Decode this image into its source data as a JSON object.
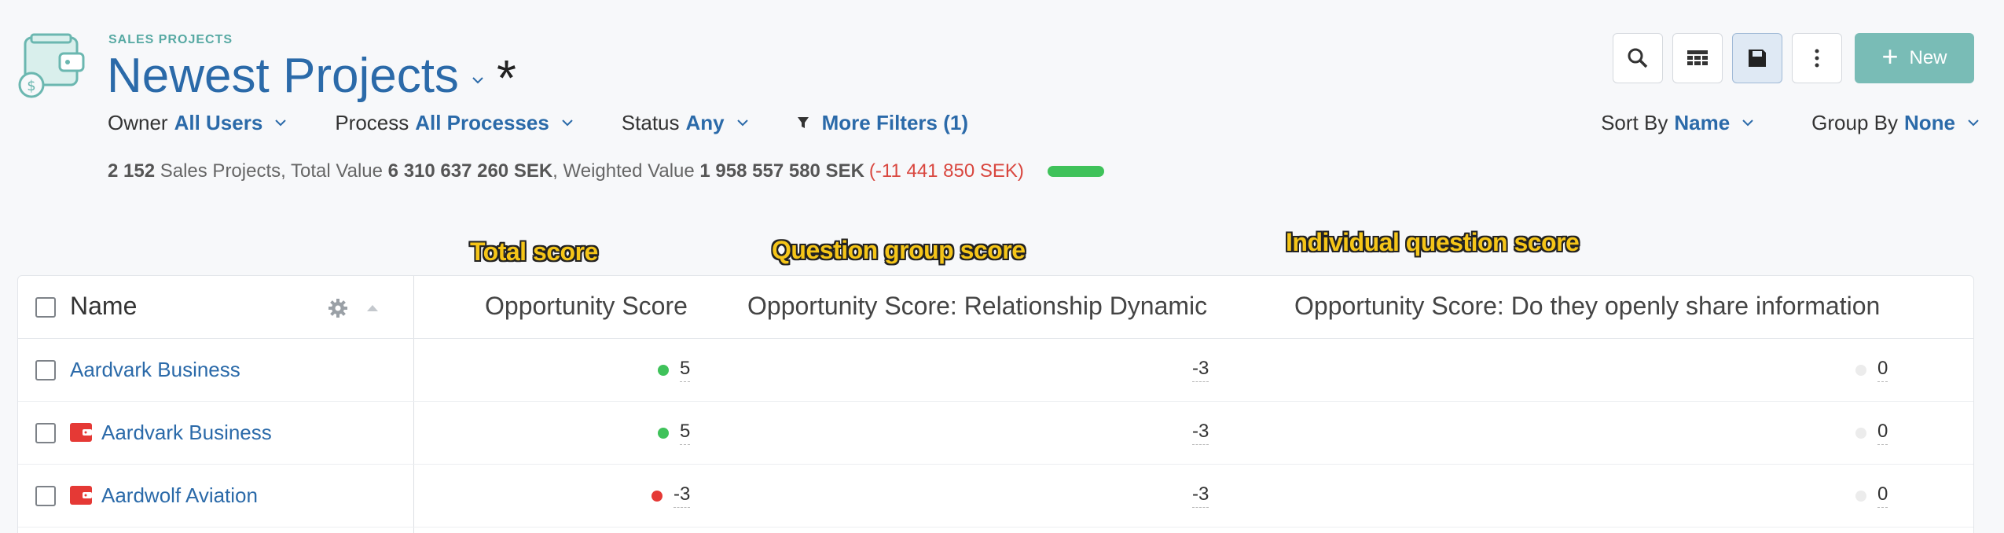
{
  "header": {
    "eyebrow": "SALES PROJECTS",
    "title": "Newest Projects",
    "unsaved_marker": "*"
  },
  "filters": {
    "owner_label": "Owner",
    "owner_value": "All Users",
    "process_label": "Process",
    "process_value": "All Processes",
    "status_label": "Status",
    "status_value": "Any",
    "more_filters": "More Filters (1)"
  },
  "sorting": {
    "sort_label": "Sort By",
    "sort_value": "Name",
    "group_label": "Group By",
    "group_value": "None"
  },
  "toolbar": {
    "new_label": "New"
  },
  "summary": {
    "count": "2 152",
    "count_text": " Sales Projects, Total Value ",
    "total_value": "6 310 637 260 SEK",
    "weighted_text": ", Weighted Value ",
    "weighted_value": "1 958 557 580 SEK",
    "delta": "(-11 441 850 SEK)"
  },
  "annotations": {
    "total": "Total score",
    "group": "Question group score",
    "individual": "Individual question score"
  },
  "table": {
    "columns": {
      "name": "Name",
      "opportunity_score": "Opportunity Score",
      "relationship_dynamic": "Opportunity Score: Relationship Dynamic",
      "share_information": "Opportunity Score: Do they openly share information"
    },
    "rows": [
      {
        "name": "Aardvark Business",
        "has_icon": false,
        "score": "5",
        "score_color": "#3fc25a",
        "group": "-3",
        "individual": "0"
      },
      {
        "name": "Aardvark Business",
        "has_icon": true,
        "score": "5",
        "score_color": "#3fc25a",
        "group": "-3",
        "individual": "0"
      },
      {
        "name": "Aardwolf Aviation",
        "has_icon": true,
        "score": "-3",
        "score_color": "#e53935",
        "group": "-3",
        "individual": "0"
      }
    ]
  },
  "colors": {
    "accent": "#2b6aa9",
    "brand_teal": "#79bcb6",
    "positive": "#3fc25a",
    "negative": "#d9473f"
  }
}
